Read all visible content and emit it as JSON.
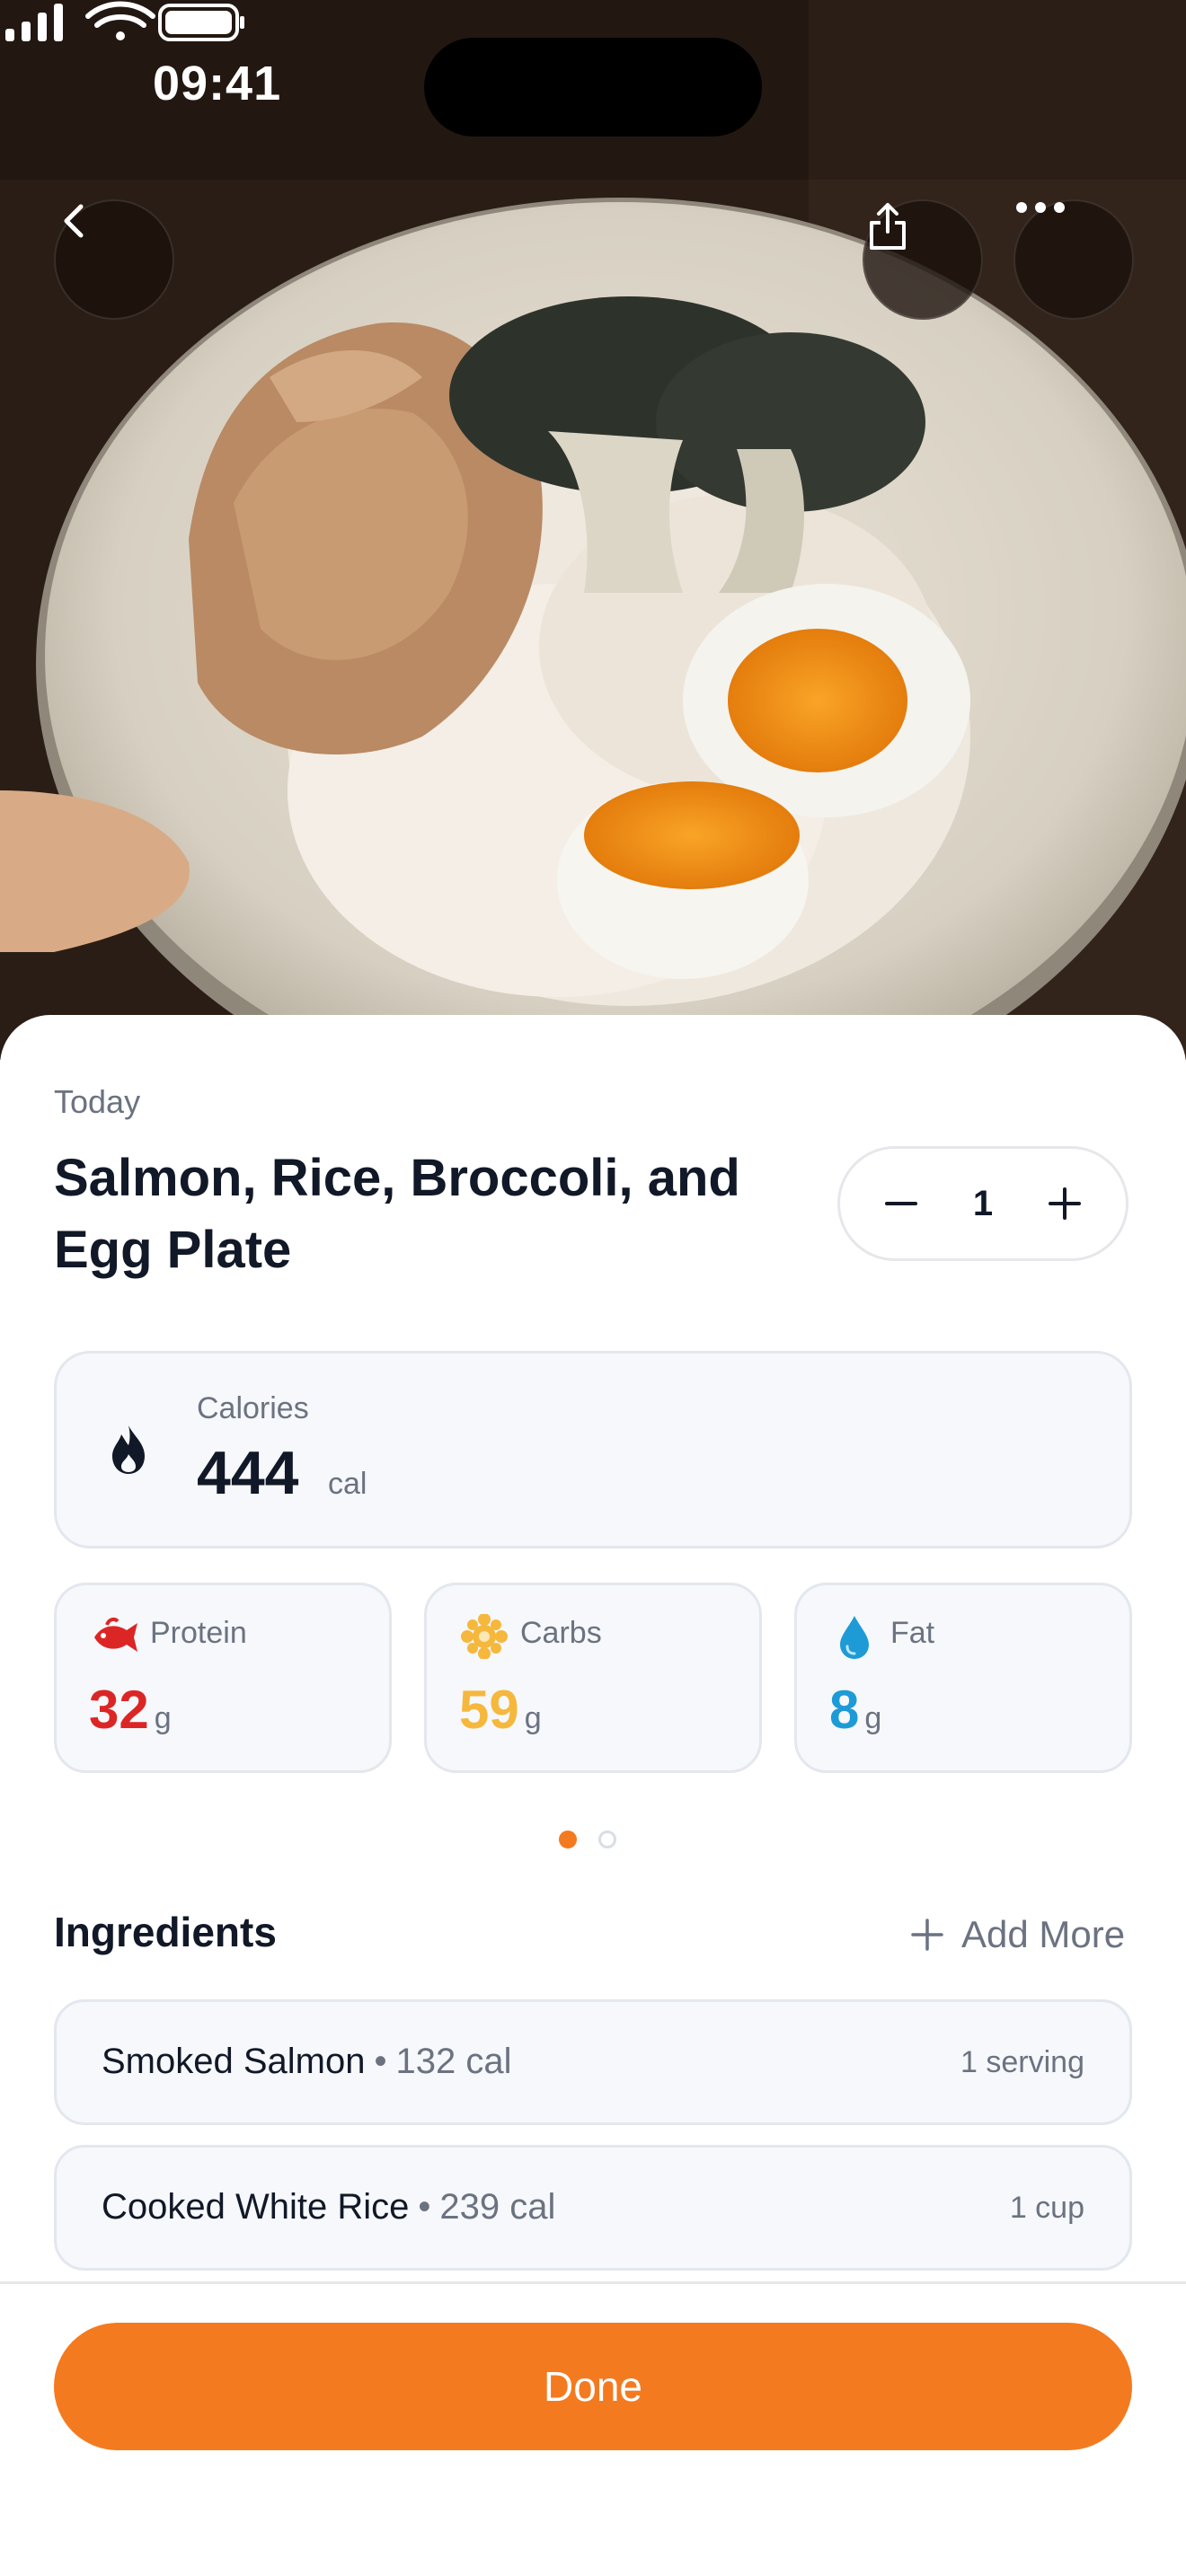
{
  "status_bar": {
    "time": "09:41"
  },
  "header": {
    "back_icon": "chevron-left-icon",
    "share_icon": "share-icon",
    "more_icon": "ellipsis-icon"
  },
  "meal": {
    "date": "Today",
    "title": "Salmon, Rice, Broccoli, and Egg Plate",
    "quantity": "1"
  },
  "calories": {
    "label": "Calories",
    "value": "444",
    "unit": "cal"
  },
  "macros": [
    {
      "name": "Protein",
      "value": "32",
      "unit": "g",
      "color": "#dc2626",
      "icon": "fish-icon"
    },
    {
      "name": "Carbs",
      "value": "59",
      "unit": "g",
      "color": "#f5b83d",
      "icon": "sun-icon"
    },
    {
      "name": "Fat",
      "value": "8",
      "unit": "g",
      "color": "#1e9bd7",
      "icon": "droplet-icon"
    }
  ],
  "pagination": {
    "total": 2,
    "active": 1
  },
  "ingredients": {
    "title": "Ingredients",
    "add_more_label": "Add More",
    "items": [
      {
        "name": "Smoked Salmon",
        "calories": "132 cal",
        "amount": "1 serving"
      },
      {
        "name": "Cooked White Rice",
        "calories": "239 cal",
        "amount": "1 cup"
      }
    ]
  },
  "actions": {
    "done_label": "Done"
  },
  "colors": {
    "accent": "#f47a1f",
    "card_bg": "#f6f8fb",
    "border": "#e3e7ee"
  }
}
